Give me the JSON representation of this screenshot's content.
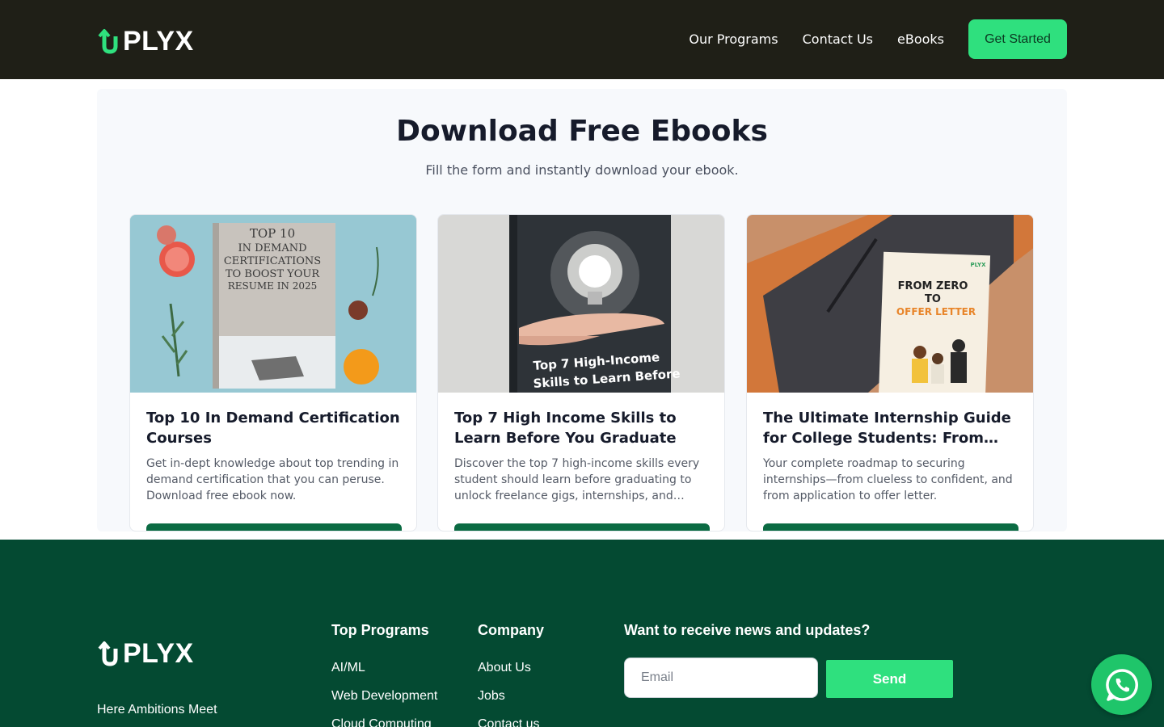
{
  "brand": {
    "name": "PLYX",
    "accent": "#2fe07e",
    "header_bg": "#1f1f17",
    "footer_bg": "#044a32",
    "button_dark": "#0b6b43"
  },
  "nav": {
    "items": [
      "Our Programs",
      "Contact Us",
      "eBooks"
    ],
    "cta_label": "Get Started"
  },
  "main": {
    "title": "Download Free Ebooks",
    "subtitle": "Fill the form and instantly download your ebook.",
    "cards": [
      {
        "title": "Top 10 In Demand Certification Courses",
        "description": "Get in-dept knowledge about top trending in demand certification that you can peruse. Download free ebook now.",
        "cover_lines": [
          "TOP 10",
          "IN DEMAND",
          "CERTIFICATIONS",
          "TO BOOST YOUR",
          "RESUME IN 2025"
        ]
      },
      {
        "title": "Top 7 High Income Skills to Learn Before You Graduate",
        "description": "Discover the top 7 high-income skills every student should learn before graduating to unlock freelance gigs, internships, and…",
        "cover_lines": [
          "Top 7 High-Income",
          "Skills to Learn Before"
        ]
      },
      {
        "title": "The Ultimate Internship Guide for College Students: From…",
        "description": "Your complete roadmap to securing internships—from clueless to confident, and from application to offer letter.",
        "cover_lines": [
          "FROM ZERO",
          "TO",
          "OFFER LETTER"
        ],
        "cover_logo": "PLYX"
      }
    ]
  },
  "footer": {
    "tagline": "Here Ambitions Meet",
    "top_programs": {
      "title": "Top Programs",
      "links": [
        "AI/ML",
        "Web Development",
        "Cloud Computing"
      ]
    },
    "company": {
      "title": "Company",
      "links": [
        "About Us",
        "Jobs",
        "Contact us"
      ]
    },
    "newsletter": {
      "title": "Want to receive news and updates?",
      "placeholder": "Email",
      "button_label": "Send"
    }
  },
  "icons": {
    "chat": "whatsapp-icon"
  }
}
